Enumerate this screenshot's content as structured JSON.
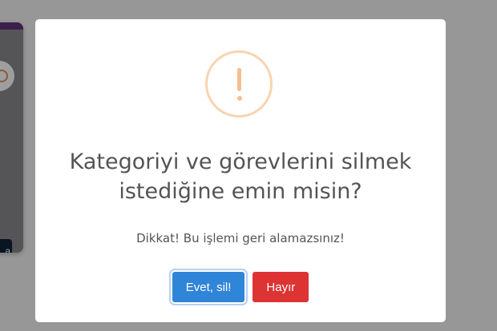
{
  "background": {
    "overlay_color": "#979797",
    "card_button_label": "a"
  },
  "dialog": {
    "icon": "warning-exclamation-icon",
    "icon_symbol": "!",
    "icon_color": "#f8bb86",
    "title": "Kategoriyi ve görevlerini silmek istediğine emin misin?",
    "text": "Dikkat! Bu işlemi geri alamazsınız!",
    "confirm_label": "Evet, sil!",
    "confirm_color": "#2f85d8",
    "cancel_label": "Hayır",
    "cancel_color": "#dd3333"
  }
}
